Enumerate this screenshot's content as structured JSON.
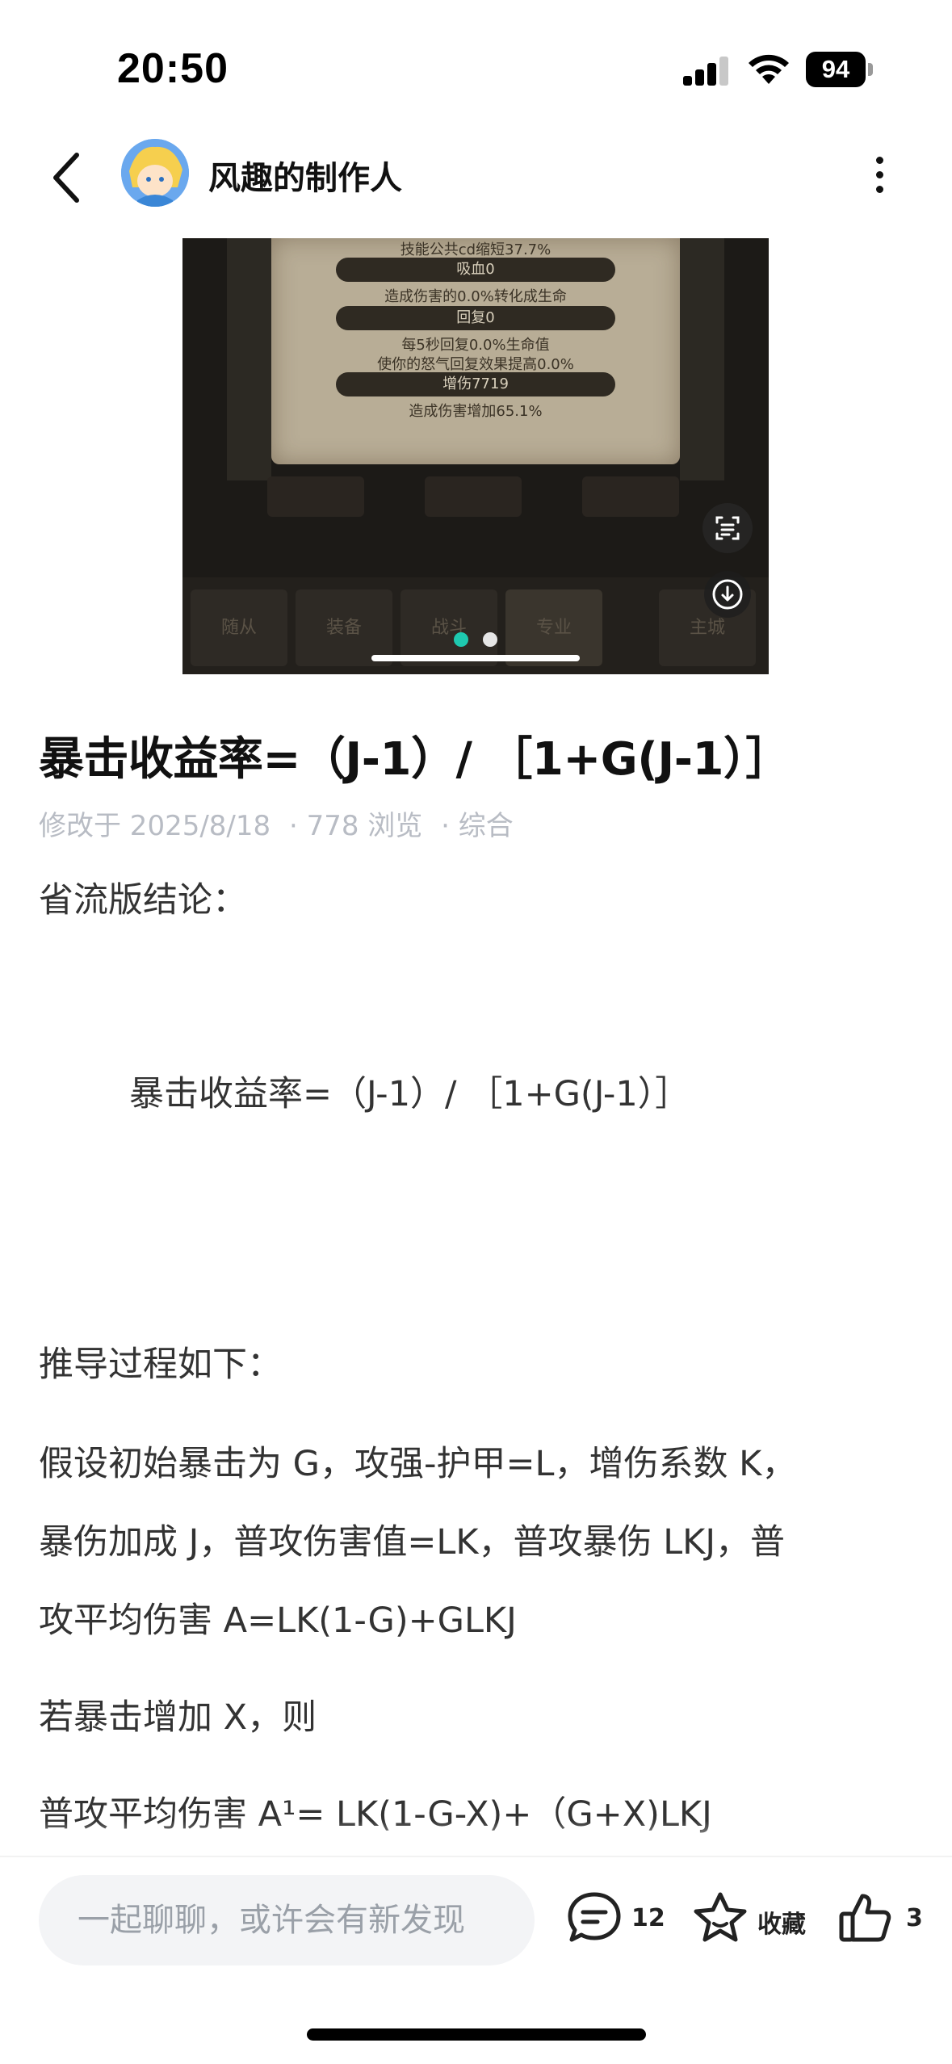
{
  "status": {
    "time": "20:50",
    "battery": "94"
  },
  "header": {
    "author": "风趣的制作人"
  },
  "image": {
    "lines": [
      "技能公共cd缩短37.7%",
      "吸血0",
      "造成伤害的0.0%转化成生命",
      "回复0",
      "每5秒回复0.0%生命值",
      "使你的怒气回复效果提高0.0%",
      "增伤7719",
      "造成伤害增加65.1%"
    ],
    "tabs": [
      "随从",
      "装备",
      "战斗",
      "专业",
      "主城"
    ],
    "page_count": 2,
    "active_page": 1
  },
  "article": {
    "title": "暴击收益率=（J-1）/ ［1+G(J-1）］",
    "meta": {
      "modified": "修改于 2025/8/18",
      "views": "· 778 浏览",
      "category": "· 综合"
    },
    "para1": "省流版结论：",
    "formula": "暴击收益率=（J-1）/ ［1+G(J-1）］",
    "para2": "推导过程如下：",
    "para3_line1": "假设初始暴击为 G，攻强-护甲=L，增伤系数 K，",
    "para3_line2": "暴伤加成 J，普攻伤害值=LK，普攻暴伤 LKJ，普",
    "para3_line3": "攻平均伤害 A=LK(1-G)+GLKJ",
    "para4": "若暴击增加 X，则",
    "para5": "普攻平均伤害 A¹= LK(1-G-X)+（G+X)LKJ"
  },
  "bottom": {
    "placeholder": "一起聊聊，或许会有新发现",
    "comments": "12",
    "favorite": "收藏",
    "likes": "3"
  },
  "colors": {
    "accent": "#1ec9b0",
    "meta": "#b8bcc4"
  }
}
